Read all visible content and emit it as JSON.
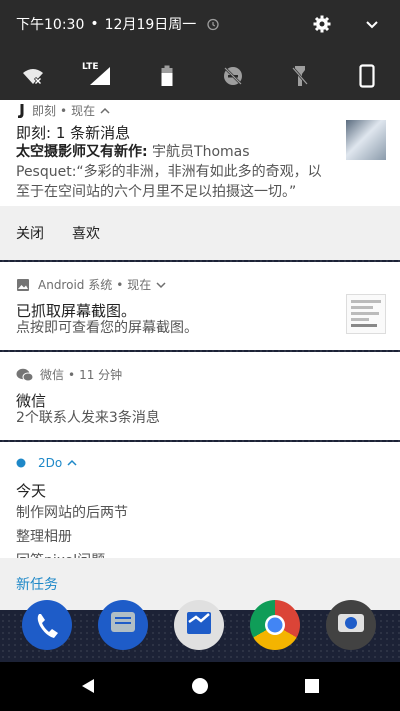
{
  "status": {
    "time": "下午10:30",
    "separator": "•",
    "date": "12月19日周一"
  },
  "quick_settings": {
    "tiles": [
      "wifi-off-icon",
      "lte-signal-icon",
      "battery-icon",
      "do-not-disturb-off-icon",
      "flashlight-off-icon",
      "rotation-icon"
    ],
    "lte_label": "LTE"
  },
  "notifications": {
    "jike": {
      "app": "即刻",
      "time": "现在",
      "title": "即刻: 1 条新消息",
      "headline": "太空摄影师又有新作:",
      "message": " 宇航员Thomas Pesquet:“多彩的非洲，非洲有如此多的奇观，以至于在空间站的六个月里不足以拍摄这一切。”",
      "actions": [
        "关闭",
        "喜欢"
      ]
    },
    "android": {
      "app": "Android 系统",
      "time": "现在",
      "title": "已抓取屏幕截图。",
      "body": "点按即可查看您的屏幕截图。"
    },
    "wechat": {
      "app": "微信",
      "time": "11 分钟",
      "title": "微信",
      "body": "2个联系人发来3条消息"
    },
    "todo": {
      "app": "2Do",
      "title": "今天",
      "tasks": [
        "制作网站的后两节",
        "整理相册",
        "回答pixel问题"
      ],
      "action": "新任务"
    }
  },
  "colors": {
    "accent": "#1e88c8",
    "panel_dark": "#2b2b2b",
    "action_bg": "#f0f0f0"
  }
}
